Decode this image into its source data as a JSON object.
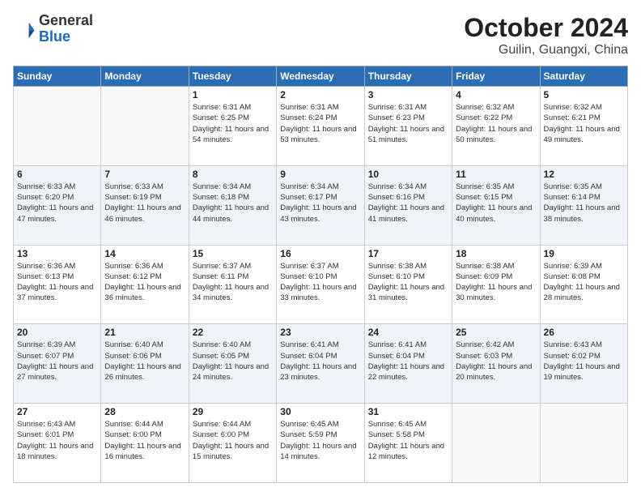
{
  "logo": {
    "general": "General",
    "blue": "Blue"
  },
  "header": {
    "month": "October 2024",
    "location": "Guilin, Guangxi, China"
  },
  "weekdays": [
    "Sunday",
    "Monday",
    "Tuesday",
    "Wednesday",
    "Thursday",
    "Friday",
    "Saturday"
  ],
  "weeks": [
    [
      {
        "day": "",
        "info": ""
      },
      {
        "day": "",
        "info": ""
      },
      {
        "day": "1",
        "sunrise": "Sunrise: 6:31 AM",
        "sunset": "Sunset: 6:25 PM",
        "daylight": "Daylight: 11 hours and 54 minutes."
      },
      {
        "day": "2",
        "sunrise": "Sunrise: 6:31 AM",
        "sunset": "Sunset: 6:24 PM",
        "daylight": "Daylight: 11 hours and 53 minutes."
      },
      {
        "day": "3",
        "sunrise": "Sunrise: 6:31 AM",
        "sunset": "Sunset: 6:23 PM",
        "daylight": "Daylight: 11 hours and 51 minutes."
      },
      {
        "day": "4",
        "sunrise": "Sunrise: 6:32 AM",
        "sunset": "Sunset: 6:22 PM",
        "daylight": "Daylight: 11 hours and 50 minutes."
      },
      {
        "day": "5",
        "sunrise": "Sunrise: 6:32 AM",
        "sunset": "Sunset: 6:21 PM",
        "daylight": "Daylight: 11 hours and 49 minutes."
      }
    ],
    [
      {
        "day": "6",
        "sunrise": "Sunrise: 6:33 AM",
        "sunset": "Sunset: 6:20 PM",
        "daylight": "Daylight: 11 hours and 47 minutes."
      },
      {
        "day": "7",
        "sunrise": "Sunrise: 6:33 AM",
        "sunset": "Sunset: 6:19 PM",
        "daylight": "Daylight: 11 hours and 46 minutes."
      },
      {
        "day": "8",
        "sunrise": "Sunrise: 6:34 AM",
        "sunset": "Sunset: 6:18 PM",
        "daylight": "Daylight: 11 hours and 44 minutes."
      },
      {
        "day": "9",
        "sunrise": "Sunrise: 6:34 AM",
        "sunset": "Sunset: 6:17 PM",
        "daylight": "Daylight: 11 hours and 43 minutes."
      },
      {
        "day": "10",
        "sunrise": "Sunrise: 6:34 AM",
        "sunset": "Sunset: 6:16 PM",
        "daylight": "Daylight: 11 hours and 41 minutes."
      },
      {
        "day": "11",
        "sunrise": "Sunrise: 6:35 AM",
        "sunset": "Sunset: 6:15 PM",
        "daylight": "Daylight: 11 hours and 40 minutes."
      },
      {
        "day": "12",
        "sunrise": "Sunrise: 6:35 AM",
        "sunset": "Sunset: 6:14 PM",
        "daylight": "Daylight: 11 hours and 38 minutes."
      }
    ],
    [
      {
        "day": "13",
        "sunrise": "Sunrise: 6:36 AM",
        "sunset": "Sunset: 6:13 PM",
        "daylight": "Daylight: 11 hours and 37 minutes."
      },
      {
        "day": "14",
        "sunrise": "Sunrise: 6:36 AM",
        "sunset": "Sunset: 6:12 PM",
        "daylight": "Daylight: 11 hours and 36 minutes."
      },
      {
        "day": "15",
        "sunrise": "Sunrise: 6:37 AM",
        "sunset": "Sunset: 6:11 PM",
        "daylight": "Daylight: 11 hours and 34 minutes."
      },
      {
        "day": "16",
        "sunrise": "Sunrise: 6:37 AM",
        "sunset": "Sunset: 6:10 PM",
        "daylight": "Daylight: 11 hours and 33 minutes."
      },
      {
        "day": "17",
        "sunrise": "Sunrise: 6:38 AM",
        "sunset": "Sunset: 6:10 PM",
        "daylight": "Daylight: 11 hours and 31 minutes."
      },
      {
        "day": "18",
        "sunrise": "Sunrise: 6:38 AM",
        "sunset": "Sunset: 6:09 PM",
        "daylight": "Daylight: 11 hours and 30 minutes."
      },
      {
        "day": "19",
        "sunrise": "Sunrise: 6:39 AM",
        "sunset": "Sunset: 6:08 PM",
        "daylight": "Daylight: 11 hours and 28 minutes."
      }
    ],
    [
      {
        "day": "20",
        "sunrise": "Sunrise: 6:39 AM",
        "sunset": "Sunset: 6:07 PM",
        "daylight": "Daylight: 11 hours and 27 minutes."
      },
      {
        "day": "21",
        "sunrise": "Sunrise: 6:40 AM",
        "sunset": "Sunset: 6:06 PM",
        "daylight": "Daylight: 11 hours and 26 minutes."
      },
      {
        "day": "22",
        "sunrise": "Sunrise: 6:40 AM",
        "sunset": "Sunset: 6:05 PM",
        "daylight": "Daylight: 11 hours and 24 minutes."
      },
      {
        "day": "23",
        "sunrise": "Sunrise: 6:41 AM",
        "sunset": "Sunset: 6:04 PM",
        "daylight": "Daylight: 11 hours and 23 minutes."
      },
      {
        "day": "24",
        "sunrise": "Sunrise: 6:41 AM",
        "sunset": "Sunset: 6:04 PM",
        "daylight": "Daylight: 11 hours and 22 minutes."
      },
      {
        "day": "25",
        "sunrise": "Sunrise: 6:42 AM",
        "sunset": "Sunset: 6:03 PM",
        "daylight": "Daylight: 11 hours and 20 minutes."
      },
      {
        "day": "26",
        "sunrise": "Sunrise: 6:43 AM",
        "sunset": "Sunset: 6:02 PM",
        "daylight": "Daylight: 11 hours and 19 minutes."
      }
    ],
    [
      {
        "day": "27",
        "sunrise": "Sunrise: 6:43 AM",
        "sunset": "Sunset: 6:01 PM",
        "daylight": "Daylight: 11 hours and 18 minutes."
      },
      {
        "day": "28",
        "sunrise": "Sunrise: 6:44 AM",
        "sunset": "Sunset: 6:00 PM",
        "daylight": "Daylight: 11 hours and 16 minutes."
      },
      {
        "day": "29",
        "sunrise": "Sunrise: 6:44 AM",
        "sunset": "Sunset: 6:00 PM",
        "daylight": "Daylight: 11 hours and 15 minutes."
      },
      {
        "day": "30",
        "sunrise": "Sunrise: 6:45 AM",
        "sunset": "Sunset: 5:59 PM",
        "daylight": "Daylight: 11 hours and 14 minutes."
      },
      {
        "day": "31",
        "sunrise": "Sunrise: 6:45 AM",
        "sunset": "Sunset: 5:58 PM",
        "daylight": "Daylight: 11 hours and 12 minutes."
      },
      {
        "day": "",
        "info": ""
      },
      {
        "day": "",
        "info": ""
      }
    ]
  ]
}
